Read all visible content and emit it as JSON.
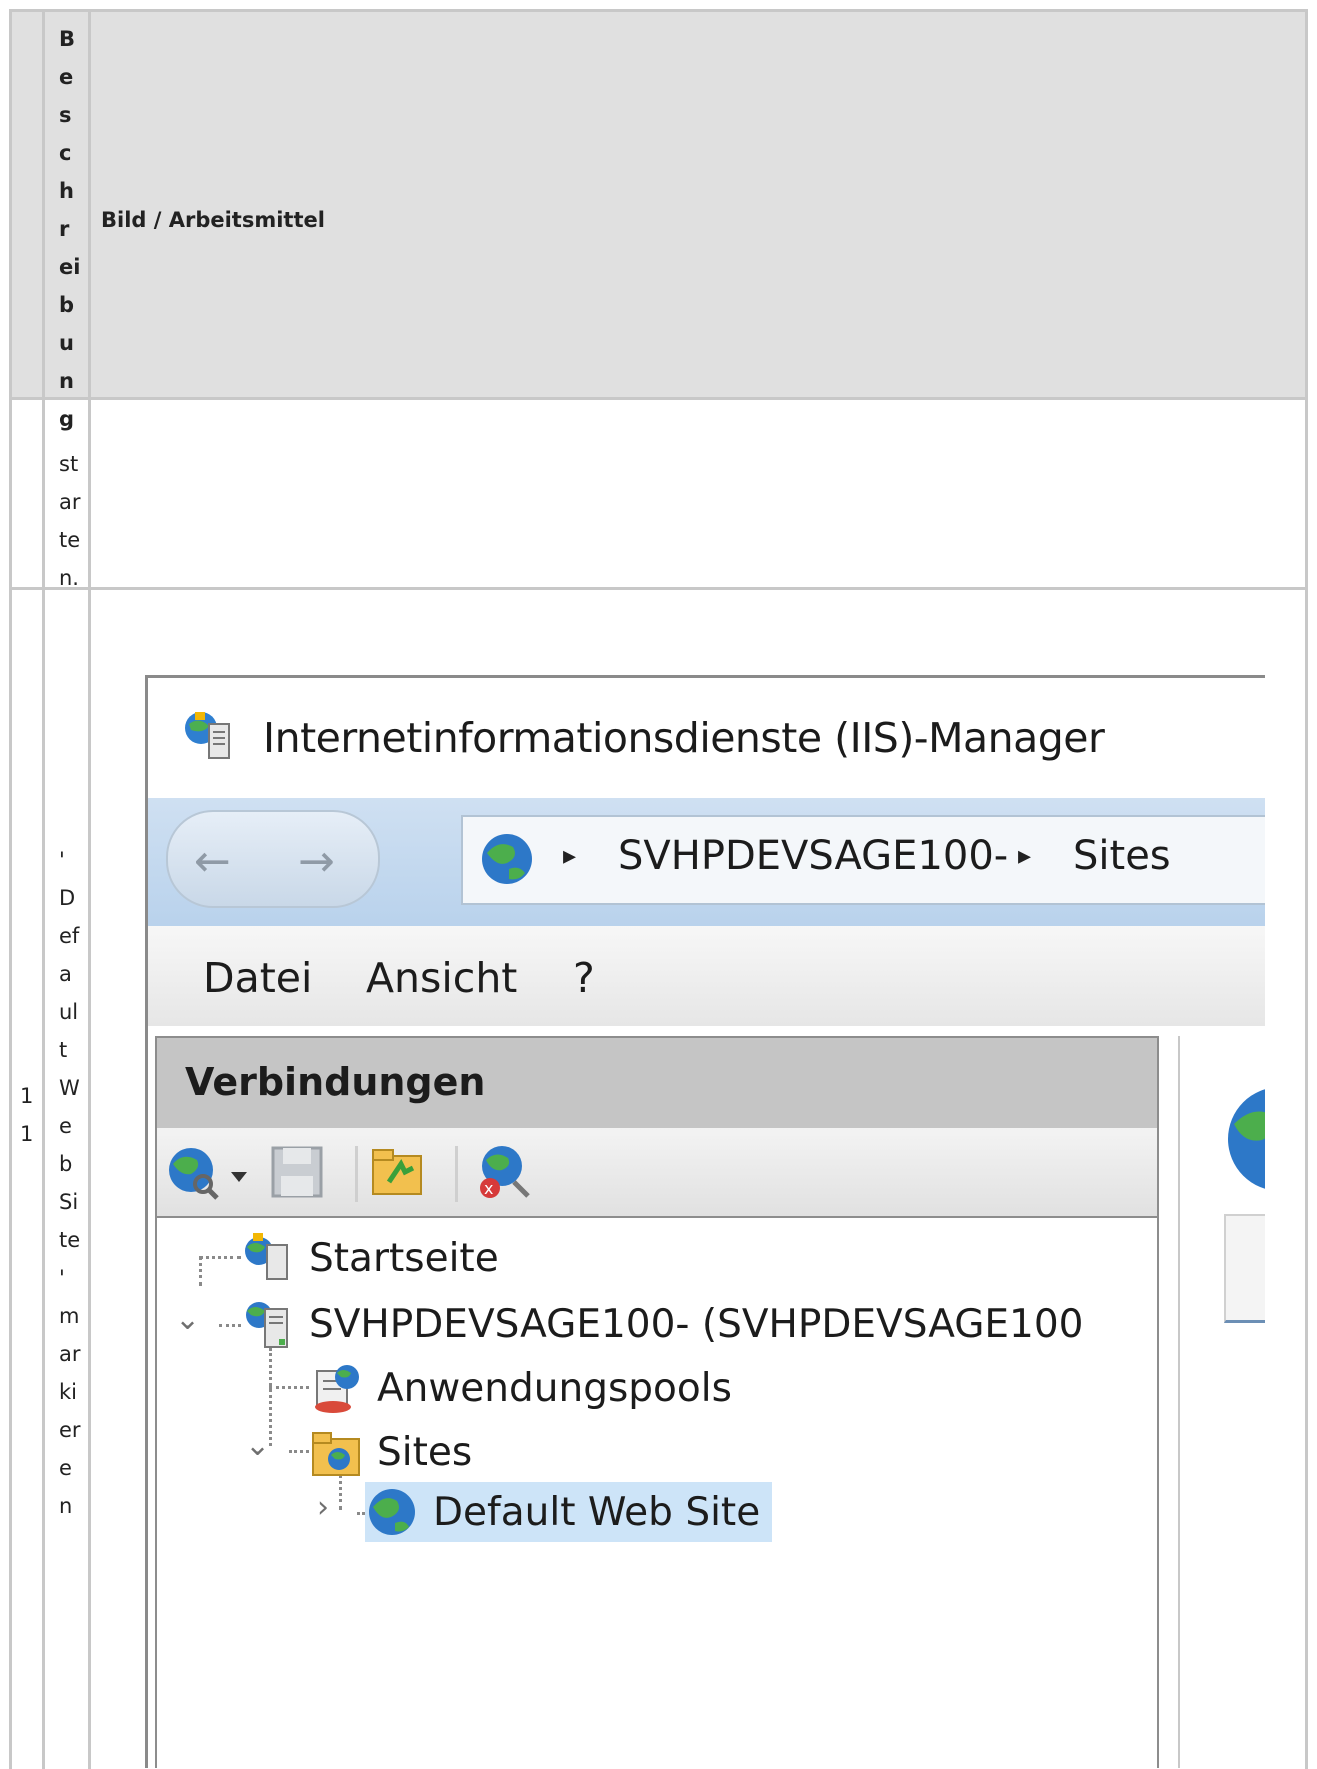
{
  "doc_table": {
    "header_col2_letters": [
      "B",
      "e",
      "s",
      "c",
      "h",
      "r",
      "ei",
      "b",
      "u",
      "n",
      "g"
    ],
    "header_col3": "Bild / Arbeitsmittel",
    "row1_col2_letters": [
      "'",
      "st",
      "ar",
      "te",
      "n."
    ],
    "row2_col1_letters": [
      "1",
      "1"
    ],
    "row2_col2_letters": [
      "'",
      "D",
      "ef",
      "a",
      "ul",
      "t",
      "W",
      "e",
      "b",
      "Si",
      "te",
      "'",
      "m",
      "ar",
      "ki",
      "er",
      "e",
      "n"
    ]
  },
  "iis": {
    "window_title": "Internetinformationsdienste (IIS)-Manager",
    "nav_back": "←",
    "nav_forward": "→",
    "breadcrumb": [
      "SVHPDEVSAGE100-",
      "Sites"
    ],
    "breadcrumb_separator": "▸",
    "menu": [
      "Datei",
      "Ansicht",
      "?"
    ],
    "connections_title": "Verbindungen",
    "toolbar_icons": [
      "connect-globe-icon",
      "save-icon",
      "up-folder-icon",
      "disconnect-icon"
    ],
    "tree": {
      "start": "Startseite",
      "server": "SVHPDEVSAGE100- (SVHPDEVSAGE100",
      "app_pools": "Anwendungspools",
      "sites": "Sites",
      "default_site": "Default Web Site"
    },
    "expand_glyph": "⌄",
    "collapsed_glyph": "›",
    "colors": {
      "selection": "#cde4f8",
      "addressbar": "#c2d8ef",
      "panel_header": "#c5c5c5"
    }
  }
}
